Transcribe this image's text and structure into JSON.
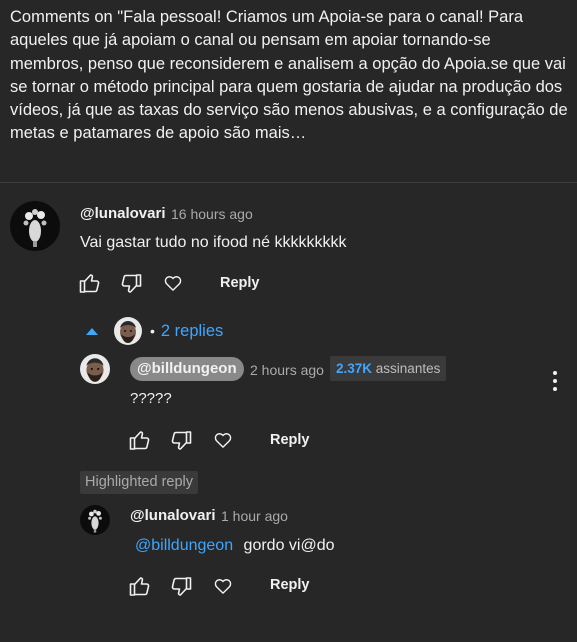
{
  "header": {
    "text": "Comments on \"Fala pessoal! Criamos um Apoia-se para o canal! Para aqueles que já apoiam o canal ou pensam em apoiar tornando-se membros, penso que reconsiderem e analisem a opção do Apoia.se que vai se tornar o método principal para quem gostaria de ajudar na produção dos vídeos, já que as taxas do serviço são menos abusivas, e a configuração de metas e patamares de apoio são mais…"
  },
  "comment": {
    "author": "@lunalovari",
    "time": "16 hours ago",
    "text": "Vai gastar tudo no ifood né kkkkkkkkk",
    "reply_label": "Reply"
  },
  "replies_toggle": {
    "label": "2 replies",
    "separator": "•"
  },
  "reply1": {
    "author": "@billdungeon",
    "time": "2 hours ago",
    "subs_count": "2.37K",
    "subs_label": "assinantes",
    "text": "?????",
    "reply_label": "Reply"
  },
  "highlighted_label": "Highlighted reply",
  "reply2": {
    "author": "@lunalovari",
    "time": "1 hour ago",
    "mention": "@billdungeon",
    "text": "gordo vi@do",
    "reply_label": "Reply"
  },
  "icons": {
    "like": "thumbs-up-icon",
    "dislike": "thumbs-down-icon",
    "heart": "heart-icon",
    "collapse": "caret-up-icon",
    "more": "kebab-menu-icon"
  },
  "colors": {
    "background": "#272727",
    "text": "#f1f1f1",
    "secondary": "#aaaaaa",
    "link": "#3ea6ff",
    "author_pill": "#898989"
  }
}
